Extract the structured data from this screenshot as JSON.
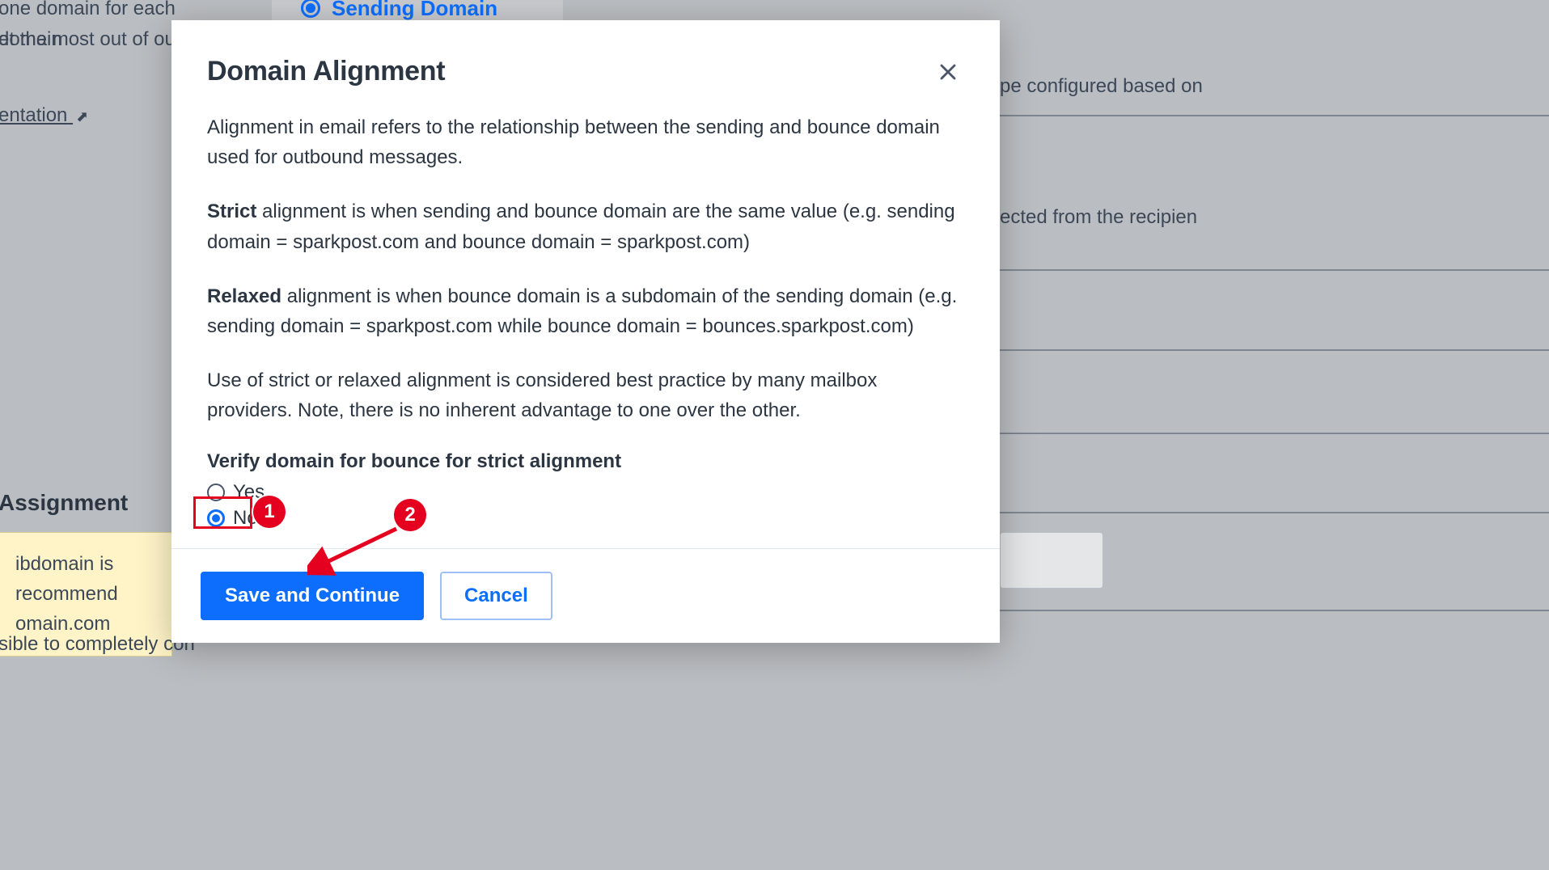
{
  "background": {
    "text_top_fragment_1": "one domain for each domain",
    "text_top_fragment_2": "et the most out of our s",
    "doc_link_text": "entation",
    "sending_domain_label": "Sending Domain",
    "right_fragment_1": "pe configured based on",
    "right_fragment_2": "ected from the recipien",
    "subaccount_title": "Assignment",
    "highlight_line_1": "ibdomain is recommend",
    "highlight_line_2": "omain.com",
    "bottom_fragment": "sible to completely con"
  },
  "modal": {
    "title": "Domain Alignment",
    "para_intro": "Alignment in email refers to the relationship between the sending and bounce domain used for outbound messages.",
    "strict_label": "Strict",
    "para_strict_rest": " alignment is when sending and bounce domain are the same value (e.g. sending domain = sparkpost.com and bounce domain = sparkpost.com)",
    "relaxed_label": "Relaxed",
    "para_relaxed_rest": " alignment is when bounce domain is a subdomain of the sending domain (e.g. sending domain = sparkpost.com while bounce domain = bounces.sparkpost.com)",
    "para_note": "Use of strict or relaxed alignment is considered best practice by many mailbox providers. Note, there is no inherent advantage to one over the other.",
    "question": "Verify domain for bounce for strict alignment",
    "option_yes": "Yes",
    "option_no": "No",
    "save_label": "Save and Continue",
    "cancel_label": "Cancel"
  },
  "annotations": {
    "badge_1": "1",
    "badge_2": "2"
  }
}
